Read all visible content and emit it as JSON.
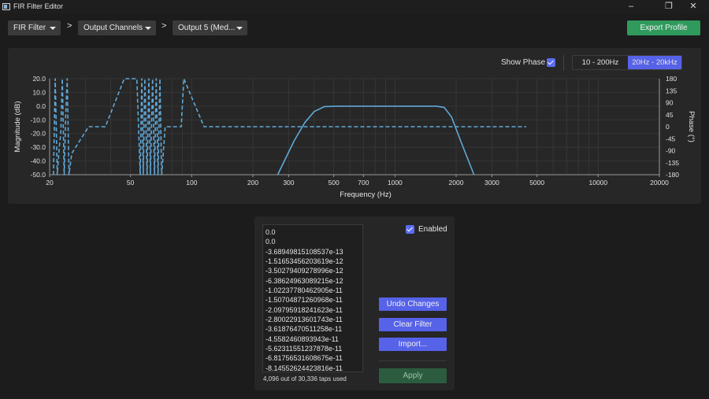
{
  "window": {
    "title": "FIR Filter Editor",
    "controls": [
      "minimize",
      "restore",
      "close"
    ]
  },
  "nav": {
    "filter_select": "FIR Filter",
    "separator": ">",
    "channel_group_select": "Output Channels",
    "channel_select": "Output 5 (Med...",
    "export_label": "Export Profile"
  },
  "chart_controls": {
    "show_phase_label": "Show Phase",
    "show_phase_checked": true,
    "range_options": [
      "10 - 200Hz",
      "20Hz - 20kHz"
    ],
    "range_selected": "20Hz - 20kHz"
  },
  "chart_data": {
    "type": "line",
    "xlabel": "Frequency (Hz)",
    "ylabel": "Magnitude (dB)",
    "y2label": "Phase (°)",
    "xscale": "log",
    "xlim": [
      20,
      20000
    ],
    "ylim": [
      -50,
      20
    ],
    "y2lim": [
      -180,
      180
    ],
    "xticks": [
      20,
      50,
      100,
      200,
      300,
      500,
      700,
      1000,
      2000,
      3000,
      5000,
      10000,
      20000
    ],
    "xtick_labels": [
      "20",
      "50",
      "100",
      "200",
      "300",
      "500",
      "700",
      "1000",
      "2000",
      "3000",
      "5000",
      "10000",
      "20000"
    ],
    "yticks": [
      "20.0",
      "10.0",
      "0.0",
      "-10.0",
      "-20.0",
      "-30.0",
      "-40.0",
      "-50.0"
    ],
    "y2ticks": [
      "180",
      "135",
      "90",
      "45",
      "0",
      "-45",
      "-90",
      "-135",
      "-180"
    ],
    "grid": true,
    "series": [
      {
        "style": "solid",
        "axis": "magnitude",
        "color": "#5fa8d8",
        "x": [
          265,
          290,
          320,
          360,
          400,
          450,
          520,
          700,
          1000,
          1400,
          1600,
          1750,
          1900,
          2100,
          2450
        ],
        "y": [
          -50,
          -38,
          -25,
          -12,
          -4,
          -0.3,
          0,
          0,
          0,
          0,
          0,
          -1,
          -8,
          -25,
          -50
        ]
      },
      {
        "style": "dashed",
        "axis": "phase",
        "color": "#5fa8d8",
        "x": [
          20.9,
          21.3,
          21.8,
          22.3,
          22.7,
          23.1,
          23.6,
          24.0,
          24.4,
          24.9,
          25.7,
          31.1,
          37.6,
          46.6,
          53.7,
          55.8,
          56.8,
          57.8,
          58.8,
          60.3,
          61.6,
          62.6,
          64.2,
          65.6,
          66.9,
          68.3,
          69.8,
          71.2,
          74.1,
          88.8,
          91.5,
          115,
          4420
        ],
        "y": [
          -180,
          180,
          -180,
          -80,
          -20,
          180,
          -180,
          40,
          180,
          -180,
          -100,
          0,
          0,
          180,
          180,
          -180,
          180,
          -180,
          180,
          -180,
          180,
          -180,
          180,
          -180,
          180,
          -180,
          180,
          -180,
          0,
          0,
          180,
          0,
          0
        ]
      }
    ]
  },
  "coefficients": {
    "values": [
      "0.0",
      "0.0",
      "-3.68949815108537e-13",
      "-1.51653456203619e-12",
      "-3.50279409278996e-12",
      "-6.38624963089215e-12",
      "-1.02237780462905e-11",
      "-1.50704871260968e-11",
      "-2.09795918241623e-11",
      "-2.80022913601743e-11",
      "-3.61876470511258e-11",
      "-4.5582460893943e-11",
      "-5.62311551237878e-11",
      "-6.81756531608675e-11",
      "-8.14552624423816e-11"
    ],
    "taps_text": "4,096 out of 30,336 taps used",
    "enabled_label": "Enabled",
    "enabled_checked": true,
    "undo_label": "Undo Changes",
    "clear_label": "Clear Filter",
    "import_label": "Import...",
    "apply_label": "Apply"
  }
}
